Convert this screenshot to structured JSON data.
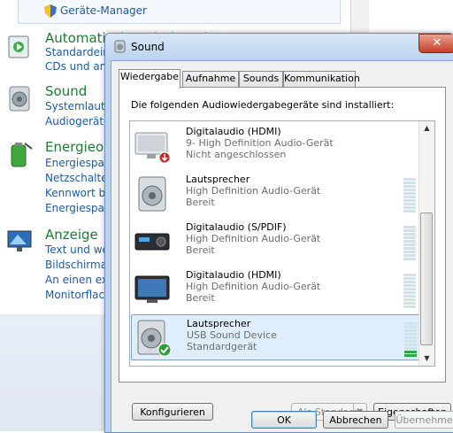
{
  "control_panel": {
    "top_item": "Geräte-Manager",
    "sections": [
      {
        "title": "Automatische Wiedergabe",
        "links": [
          "Standardeinstellungen für Medien oder Geräte ändern",
          "CDs und andere Medien automatisch wiedergeben"
        ]
      },
      {
        "title": "Sound",
        "links": [
          "Systemlautstärke anpassen",
          "Audiogeräte verwalten"
        ]
      },
      {
        "title": "Energieoptionen",
        "links": [
          "Energiesparmodus ändern",
          "Netzschalterverhalten ändern",
          "Kennwort beim Reaktivieren anfordern",
          "Energiesparplan auswählen"
        ]
      },
      {
        "title": "Anzeige",
        "links": [
          "Text und weitere Elemente vergrößern oder verkleinern",
          "Bildschirmauflösung anpassen",
          "An einen externen Bildschirm anschließen",
          "Monitorflackern anpassen"
        ]
      }
    ]
  },
  "dialog": {
    "title": "Sound",
    "close_glyph": "✕",
    "tabs": [
      {
        "label": "Wiedergabe",
        "active": true
      },
      {
        "label": "Aufnahme",
        "active": false
      },
      {
        "label": "Sounds",
        "active": false
      },
      {
        "label": "Kommunikation",
        "active": false
      }
    ],
    "list_label": "Die folgenden Audiowiedergabegeräte sind installiert:",
    "devices": [
      {
        "name": "Digitalaudio (HDMI)",
        "description": "9- High Definition Audio-Gerät",
        "status": "Nicht angeschlossen",
        "icon": "monitor-icon",
        "badge": "red-down-arrow",
        "meter_level": 0
      },
      {
        "name": "Lautsprecher",
        "description": "High Definition Audio-Gerät",
        "status": "Bereit",
        "icon": "speaker-icon",
        "badge": null,
        "meter_level": 0
      },
      {
        "name": "Digitalaudio (S/PDIF)",
        "description": "High Definition Audio-Gerät",
        "status": "Bereit",
        "icon": "receiver-icon",
        "badge": null,
        "meter_level": 0
      },
      {
        "name": "Digitalaudio (HDMI)",
        "description": "High Definition Audio-Gerät",
        "status": "Bereit",
        "icon": "monitor-icon",
        "badge": null,
        "meter_level": 0
      },
      {
        "name": "Lautsprecher",
        "description": "USB Sound Device",
        "status": "Standardgerät",
        "icon": "speaker-icon",
        "badge": "green-check",
        "meter_level": 0.2,
        "selected": true
      }
    ],
    "buttons": {
      "configure": "Konfigurieren",
      "set_default": "Als Standard",
      "properties": "Eigenschaften",
      "ok": "OK",
      "cancel": "Abbrechen",
      "apply": "Übernehmen"
    },
    "colors": {
      "accent": "#1e5aa0",
      "title_green": "#1f7a33",
      "meter_on": "#2aa84a"
    }
  }
}
